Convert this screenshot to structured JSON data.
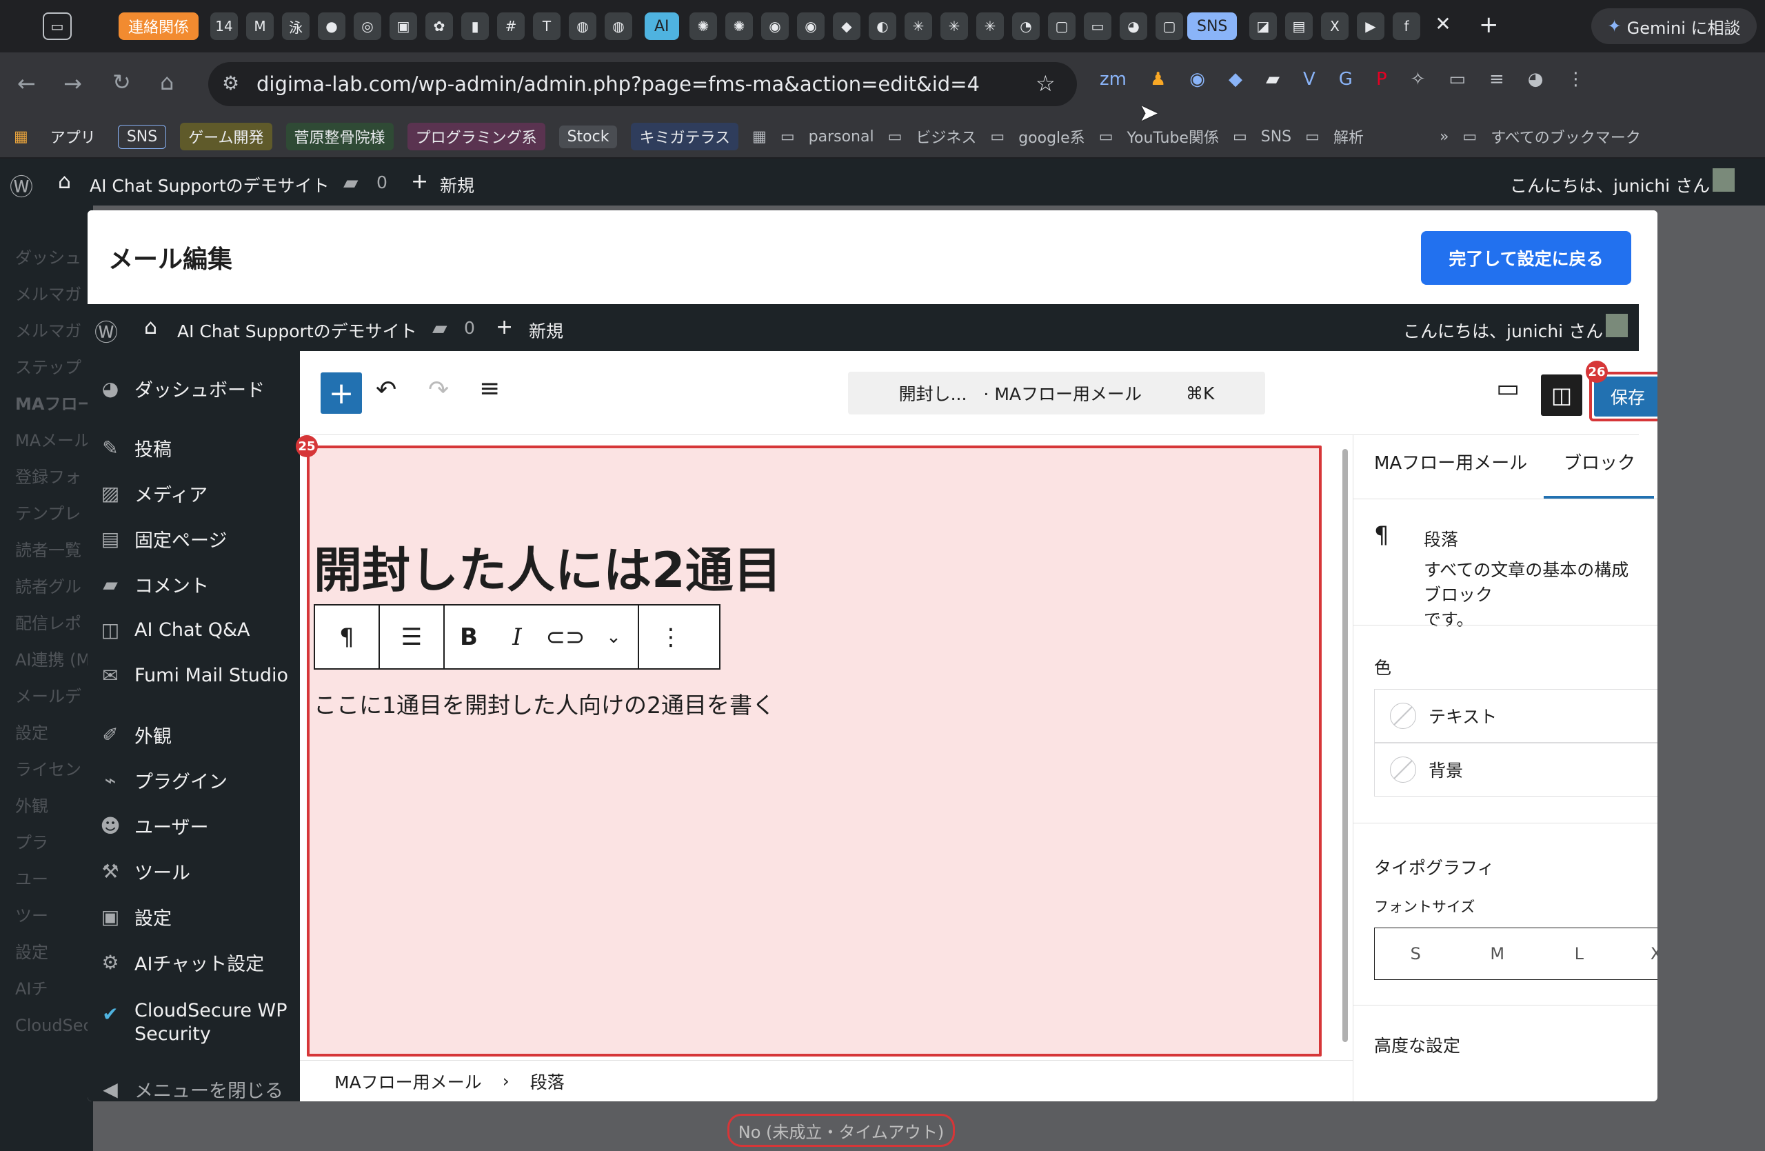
{
  "browser": {
    "tab_labels": [
      "連絡関係",
      "AI",
      "SNS"
    ],
    "gemini_label": "Gemini に相談",
    "url": "digima-lab.com/wp-admin/admin.php?page=fms-ma&action=edit&id=4",
    "bookmarks": [
      "アプリ",
      "SNS",
      "ゲーム開発",
      "菅原整骨院様",
      "プログラミング系",
      "Stock",
      "キミガテラス",
      "parsonal",
      "ビジネス",
      "google系",
      "YouTube関係",
      "SNS",
      "解析",
      "すべてのブックマーク"
    ]
  },
  "outer_admin": {
    "site_name": "AI Chat Supportのデモサイト",
    "comments": "0",
    "new_label": "新規",
    "greeting": "こんにちは、junichi さん",
    "side_items": [
      "ダッシュ",
      "メルマガ",
      "メルマガ",
      "ステップ",
      "MAフロー",
      "MAメール",
      "登録フォ",
      "テンプレ",
      "読者一覧",
      "読者グル",
      "配信レポ",
      "AI連携 (M",
      "メールデ",
      "設定",
      "ライセン",
      "外観",
      "プラ",
      "ユー",
      "ツー",
      "設定",
      "AIチ",
      "CloudSecure WP Security"
    ],
    "status_pill": "No (未成立・タイムアウト)"
  },
  "modal": {
    "title": "メール編集",
    "done_button": "完了して設定に戻る"
  },
  "inner_admin": {
    "site_name": "AI Chat Supportのデモサイト",
    "comments": "0",
    "new_label": "新規",
    "greeting": "こんにちは、junichi さん",
    "menu": [
      "ダッシュボード",
      "投稿",
      "メディア",
      "固定ページ",
      "コメント",
      "AI Chat Q&A",
      "Fumi Mail Studio",
      "外観",
      "プラグイン",
      "ユーザー",
      "ツール",
      "設定",
      "AIチャット設定",
      "CloudSecure WP",
      "Security",
      "メニューを閉じる"
    ]
  },
  "editor": {
    "command_title": "開封し...",
    "command_type": "· MAフロー用メール",
    "shortcut": "⌘K",
    "save_label": "保存",
    "badge_save": "26",
    "badge_block": "25",
    "heading": "開封した人には2通目",
    "paragraph": "ここに1通目を開封した人向けの2通目を書く",
    "breadcrumb": [
      "MAフロー用メール",
      "段落"
    ]
  },
  "sidebar": {
    "tab_doc": "MAフロー用メール",
    "tab_block": "ブロック",
    "block_name": "段落",
    "block_desc_1": "すべての文章の基本の構成ブロック",
    "block_desc_2": "です。",
    "color_title": "色",
    "color_text": "テキスト",
    "color_bg": "背景",
    "typo_title": "タイポグラフィ",
    "font_size_label": "フォントサイズ",
    "sizes": [
      "S",
      "M",
      "L",
      "XL"
    ],
    "advanced": "高度な設定"
  },
  "colors": {
    "accent": "#2271b1",
    "done": "#2271ef",
    "selection": "#d63638",
    "selection_fill": "#fbe3e3",
    "admin_bar": "#1d2327"
  }
}
